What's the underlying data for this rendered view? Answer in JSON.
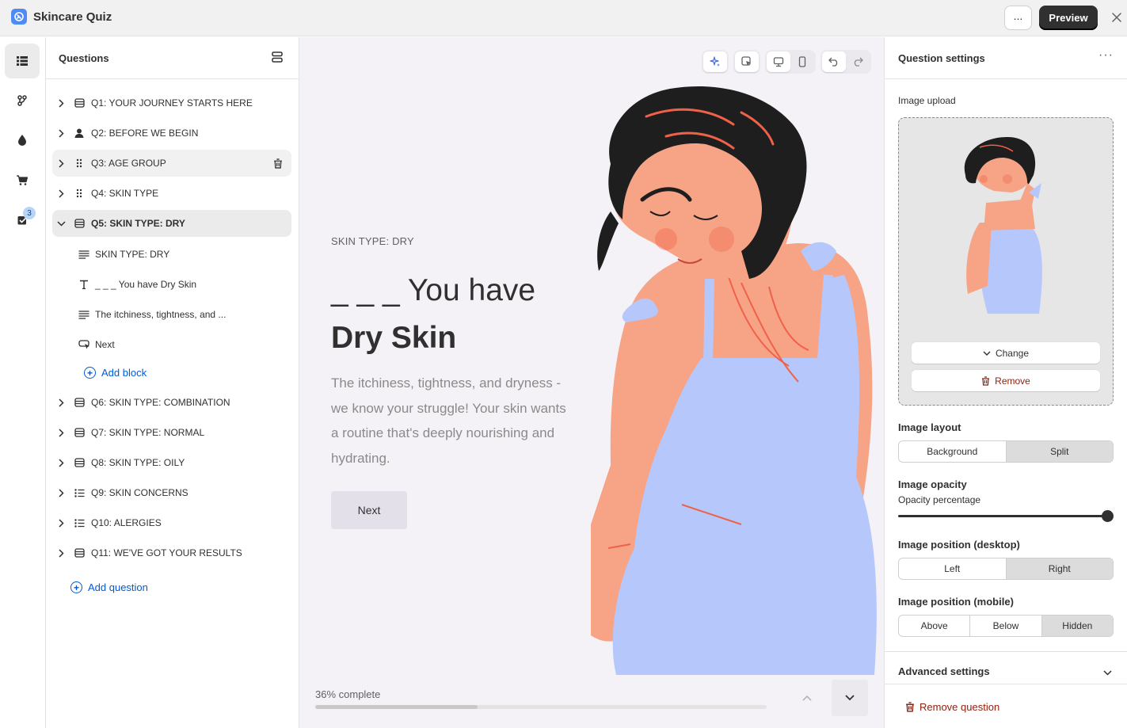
{
  "app": {
    "title": "Skincare Quiz",
    "more_label": "...",
    "preview_label": "Preview"
  },
  "rail": {
    "results_badge": "3"
  },
  "questions_panel": {
    "title": "Questions",
    "questions": [
      {
        "label": "Q1: YOUR JOURNEY STARTS HERE",
        "icon": "layout-icon"
      },
      {
        "label": "Q2: BEFORE WE BEGIN",
        "icon": "person-icon"
      },
      {
        "label": "Q3: AGE GROUP",
        "icon": "drag-handle-icon"
      },
      {
        "label": "Q4: SKIN TYPE",
        "icon": "drag-handle-icon"
      },
      {
        "label": "Q5: SKIN TYPE: DRY",
        "icon": "layout-icon"
      },
      {
        "label": "Q6: SKIN TYPE: COMBINATION",
        "icon": "layout-icon"
      },
      {
        "label": "Q7: SKIN TYPE: NORMAL",
        "icon": "layout-icon"
      },
      {
        "label": "Q8: SKIN TYPE: OILY",
        "icon": "layout-icon"
      },
      {
        "label": "Q9: SKIN CONCERNS",
        "icon": "list-icon"
      },
      {
        "label": "Q10: ALERGIES",
        "icon": "list-icon"
      },
      {
        "label": "Q11: WE'VE GOT YOUR RESULTS",
        "icon": "layout-icon"
      }
    ],
    "blocks": [
      {
        "label": "SKIN TYPE: DRY",
        "icon": "paragraph-icon"
      },
      {
        "label": "_ _ _ You have Dry Skin",
        "icon": "text-icon"
      },
      {
        "label": "The itchiness, tightness, and ...",
        "icon": "paragraph-icon"
      },
      {
        "label": "Next",
        "icon": "button-icon"
      }
    ],
    "add_block_label": "Add block",
    "add_question_label": "Add question"
  },
  "preview": {
    "subtitle": "SKIN TYPE: DRY",
    "heading_light": "_ _ _ You have",
    "heading_bold": "Dry Skin",
    "body": "The itchiness, tightness, and dryness - we know your struggle! Your skin wants a routine that's deeply nourishing and hydrating.",
    "next_label": "Next",
    "progress_text": "36% complete",
    "progress_value": 0.36
  },
  "settings": {
    "title": "Question settings",
    "more_label": "···",
    "image_upload_label": "Image upload",
    "change_label": "Change",
    "remove_label": "Remove",
    "image_layout": {
      "title": "Image layout",
      "options": [
        "Background",
        "Split"
      ],
      "selected": "Split"
    },
    "image_opacity": {
      "title": "Image opacity",
      "sub_label": "Opacity percentage",
      "value": 1.0
    },
    "position_desktop": {
      "title": "Image position (desktop)",
      "options": [
        "Left",
        "Right"
      ],
      "selected": "Right"
    },
    "position_mobile": {
      "title": "Image position (mobile)",
      "options": [
        "Above",
        "Below",
        "Hidden"
      ],
      "selected": "Hidden"
    },
    "advanced_label": "Advanced settings",
    "remove_question_label": "Remove question"
  },
  "colors": {
    "accent_link": "#005bd3",
    "danger": "#8e1f0b",
    "canvas_bg": "#f4f2f6",
    "skin": "#f7a386",
    "dress": "#b6c8fb",
    "hair": "#1e1e1e"
  }
}
